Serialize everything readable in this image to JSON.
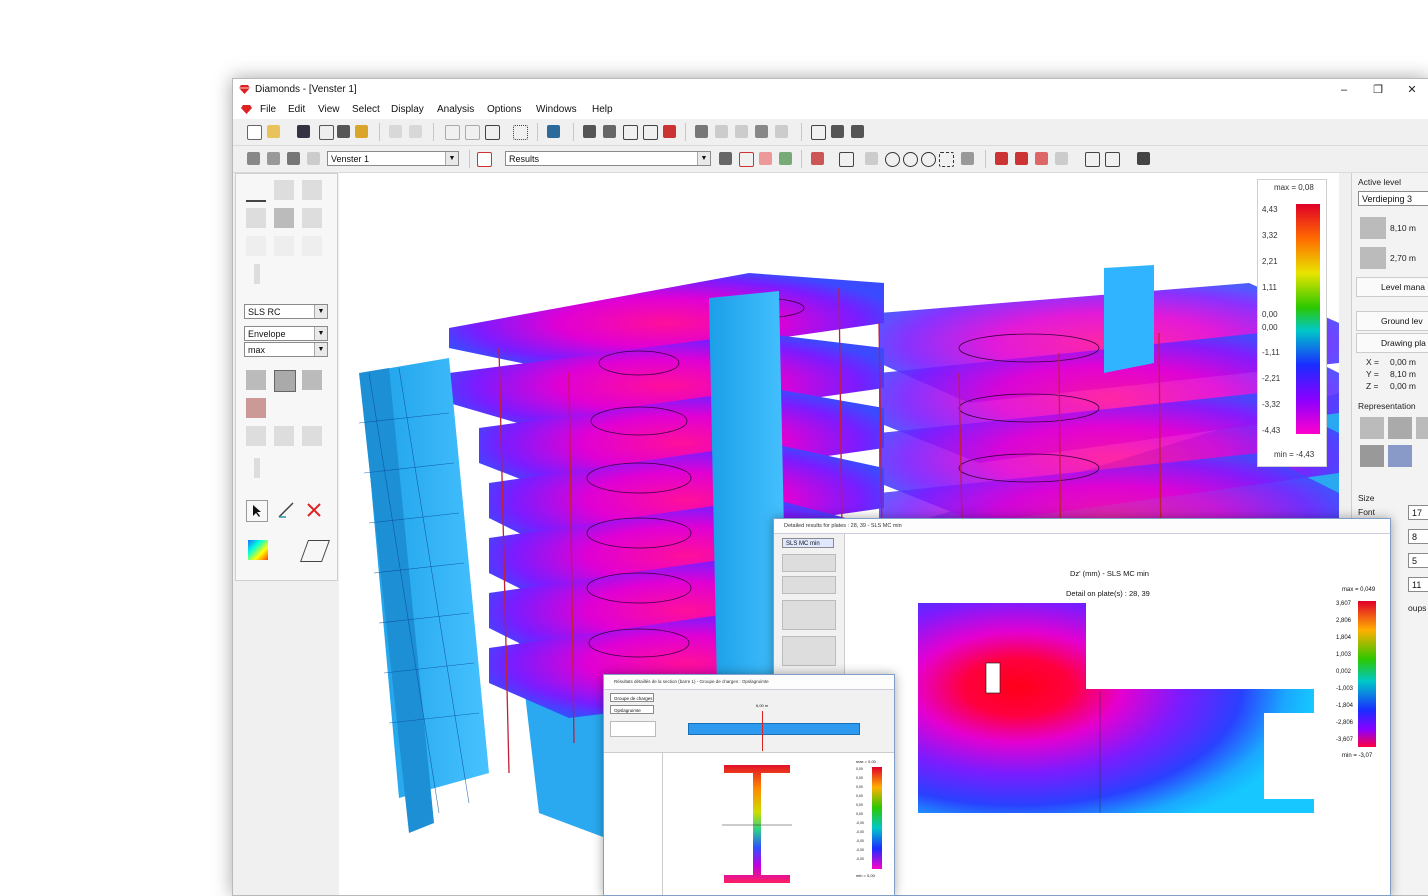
{
  "window": {
    "title": "Diamonds  -  [Venster 1]",
    "controls": {
      "minimize": "–",
      "maximize": "❐",
      "close": "✕"
    }
  },
  "menu": [
    "File",
    "Edit",
    "View",
    "Select",
    "Display",
    "Analysis",
    "Options",
    "Windows",
    "Help"
  ],
  "mdi_controls": "– ⧉",
  "toolbar2": {
    "window_select": "Venster 1",
    "view_select": "Results"
  },
  "left_panel": {
    "combo_rc": "SLS RC",
    "combo_env": "Envelope",
    "combo_max": "max"
  },
  "legend": {
    "max_label": "max = 0,08",
    "min_label": "min = -4,43",
    "ticks": [
      "4,43",
      "3,32",
      "2,21",
      "1,11",
      "0,00",
      "0,00",
      "-1,11",
      "-2,21",
      "-3,32",
      "-4,43"
    ],
    "colors": [
      "#e00028",
      "#ff4a00",
      "#ffb000",
      "#e9e400",
      "#33c800",
      "#00c8b0",
      "#0090ff",
      "#1a2cff",
      "#7b00ff",
      "#ff00cc"
    ]
  },
  "right_panel": {
    "active_level_title": "Active level",
    "active_level_value": "Verdieping 3",
    "level_height_1": "8,10 m",
    "level_height_2": "2,70 m",
    "level_manager": "Level mana",
    "ground_level": "Ground lev",
    "drawing_plane": "Drawing pla",
    "x_label": "X =",
    "x_value": "0,00 m",
    "y_label": "Y =",
    "y_value": "8,10 m",
    "z_label": "Z =",
    "z_value": "0,00 m",
    "representation": "Representation",
    "size": "Size",
    "font": "Font",
    "size_values": [
      "17",
      "8",
      "5",
      "11"
    ],
    "groups": "oups"
  },
  "dialog_plates": {
    "title": "Detailed results for plates : 28, 39  - SLS MC min",
    "combo": "SLS MC min",
    "heading": "Dz' (mm) - SLS MC min",
    "subheading": "Detail on plate(s) : 28, 39",
    "legend_max": "max = 0,049",
    "legend_min": "min = -3,07",
    "legend_ticks": [
      "3,607",
      "2,806",
      "1,804",
      "1,003",
      "0,002",
      "-1,003",
      "-1,804",
      "-2,806",
      "-3,607"
    ]
  },
  "dialog_section": {
    "title": "Résultats détaillés de la section (barre 1) - Groupe de charges : Opslagruimte",
    "combo1": "Groupe de charges",
    "combo2": "Opslagruimte",
    "length_label": "6,00 m",
    "legend_max": "max = 0,00",
    "legend_ticks": [
      "0,00",
      "0,00",
      "0,00",
      "0,00",
      "0,00",
      "0,00",
      "-0,00",
      "-0,00",
      "-0,00",
      "-0,00",
      "-0,00"
    ],
    "legend_min": "min = 0,00"
  }
}
